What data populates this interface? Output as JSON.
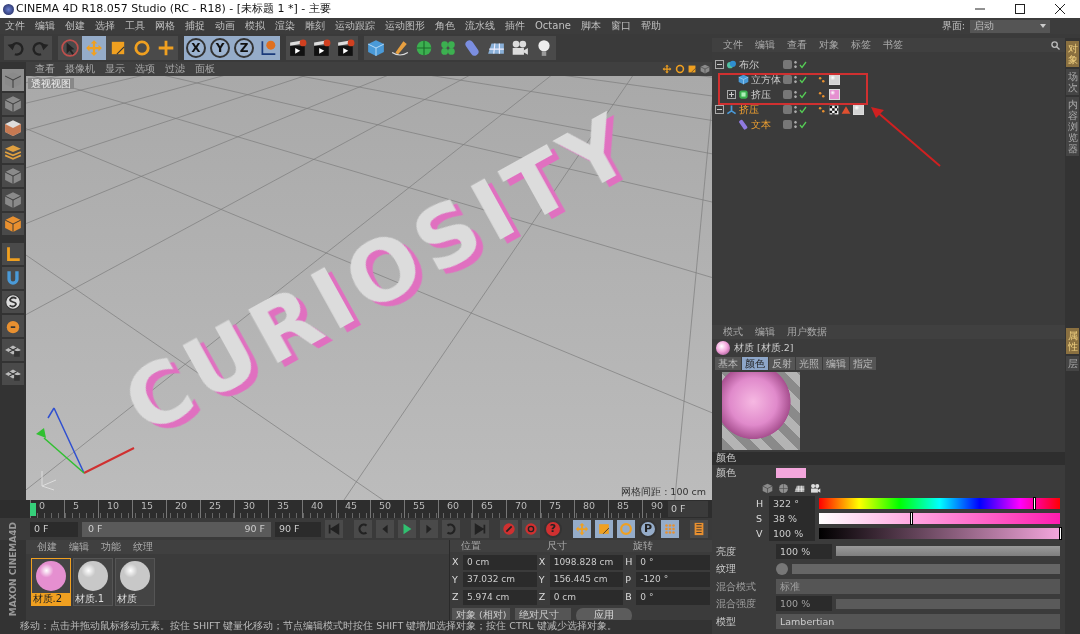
{
  "window": {
    "title": "CINEMA 4D R18.057 Studio (RC - R18) - [未标题 1 *] - 主要"
  },
  "menu": [
    "文件",
    "编辑",
    "创建",
    "选择",
    "工具",
    "网格",
    "捕捉",
    "动画",
    "模拟",
    "渲染",
    "雕刻",
    "运动跟踪",
    "运动图形",
    "角色",
    "流水线",
    "插件",
    "Octane",
    "脚本",
    "窗口",
    "帮助"
  ],
  "layout": {
    "label": "界面:",
    "value": "启动"
  },
  "toolbar": [
    {
      "kind": "undo",
      "selected": false
    },
    {
      "kind": "redo",
      "selected": false
    },
    {
      "kind": "sep"
    },
    {
      "kind": "select",
      "selected": false
    },
    {
      "kind": "move",
      "selected": true
    },
    {
      "kind": "scale",
      "selected": false
    },
    {
      "kind": "rotate",
      "selected": false
    },
    {
      "kind": "plus",
      "selected": false
    },
    {
      "kind": "sep"
    },
    {
      "kind": "axis",
      "label": "X",
      "selected": true
    },
    {
      "kind": "axis",
      "label": "Y",
      "selected": true
    },
    {
      "kind": "axis",
      "label": "Z",
      "selected": true
    },
    {
      "kind": "coords",
      "selected": true
    },
    {
      "kind": "sep"
    },
    {
      "kind": "clapper",
      "selected": false
    },
    {
      "kind": "clapper",
      "selected": false
    },
    {
      "kind": "clapper",
      "selected": false
    },
    {
      "kind": "sep"
    },
    {
      "kind": "cube",
      "selected": false
    },
    {
      "kind": "pen",
      "selected": false
    },
    {
      "kind": "subdiv",
      "selected": false
    },
    {
      "kind": "cloner",
      "selected": false
    },
    {
      "kind": "deformer",
      "selected": false
    },
    {
      "kind": "floor",
      "selected": false
    },
    {
      "kind": "camera",
      "selected": false
    },
    {
      "kind": "light",
      "selected": false
    }
  ],
  "left_tools": [
    {
      "kind": "cube-grey",
      "selected": true
    },
    {
      "kind": "cube-grey",
      "selected": false
    },
    {
      "kind": "checker",
      "selected": false
    },
    {
      "kind": "plates",
      "selected": false
    },
    {
      "kind": "cube-grey",
      "selected": false
    },
    {
      "kind": "cube-grey",
      "selected": false
    },
    {
      "kind": "cube-orange",
      "selected": false
    },
    {
      "kind": "sep"
    },
    {
      "kind": "axis-l",
      "selected": false
    },
    {
      "kind": "magnet",
      "selected": false
    },
    {
      "kind": "s-circle",
      "selected": false
    },
    {
      "kind": "lock",
      "selected": false
    },
    {
      "kind": "grid-lock",
      "selected": false
    },
    {
      "kind": "grid-lock",
      "selected": false
    }
  ],
  "viewport": {
    "menu": [
      "查看",
      "摄像机",
      "显示",
      "选项",
      "过滤",
      "面板"
    ],
    "view_name": "透视视图",
    "model_text": "CURIOSITY",
    "grid_spacing": "网格间距 : 100 cm"
  },
  "timeline": {
    "ticks": [
      "0",
      "5",
      "10",
      "15",
      "20",
      "25",
      "30",
      "35",
      "40",
      "45",
      "50",
      "55",
      "60",
      "65",
      "70",
      "75",
      "80",
      "85",
      "90"
    ],
    "level": 0,
    "current": "0 F"
  },
  "playback": {
    "start": "0 F",
    "range_start": "0 F",
    "range_end": "90 F",
    "end": "90 F",
    "controls": [
      {
        "kind": "to-start",
        "selected": false
      },
      {
        "kind": "sep"
      },
      {
        "kind": "prev-key",
        "selected": false
      },
      {
        "kind": "prev-frame",
        "selected": false
      },
      {
        "kind": "play",
        "selected": false
      },
      {
        "kind": "next-frame",
        "selected": false
      },
      {
        "kind": "next-key",
        "selected": false
      },
      {
        "kind": "sep"
      },
      {
        "kind": "to-end",
        "selected": false
      },
      {
        "kind": "sep"
      },
      {
        "kind": "record",
        "selected": false
      },
      {
        "kind": "autokey",
        "selected": false
      },
      {
        "kind": "keyhelp",
        "label": "?",
        "selected": false
      },
      {
        "kind": "sep"
      },
      {
        "kind": "move",
        "selected": true
      },
      {
        "kind": "scale",
        "selected": true
      },
      {
        "kind": "rotate",
        "selected": true
      },
      {
        "kind": "param",
        "label": "P",
        "selected": true
      },
      {
        "kind": "dots",
        "selected": true
      },
      {
        "kind": "sep"
      },
      {
        "kind": "film",
        "selected": false
      }
    ]
  },
  "materials": {
    "menu": [
      "创建",
      "编辑",
      "功能",
      "纹理"
    ],
    "items": [
      {
        "name": "材质.2",
        "color": "#e58fd0",
        "selected": true
      },
      {
        "name": "材质.1",
        "color": "#c8c8c8",
        "selected": false
      },
      {
        "name": "材质",
        "color": "#c8c8c8",
        "selected": false
      }
    ]
  },
  "coordinates": {
    "headers": [
      "位置",
      "尺寸",
      "旋转"
    ],
    "rows": [
      [
        {
          "axis": "X",
          "value": "0 cm"
        },
        {
          "axis": "X",
          "value": "1098.828 cm"
        },
        {
          "axis": "H",
          "value": "0 °"
        }
      ],
      [
        {
          "axis": "Y",
          "value": "37.032 cm"
        },
        {
          "axis": "Y",
          "value": "156.445 cm"
        },
        {
          "axis": "P",
          "value": "-120 °"
        }
      ],
      [
        {
          "axis": "Z",
          "value": "5.974 cm"
        },
        {
          "axis": "Z",
          "value": "0 cm"
        },
        {
          "axis": "B",
          "value": "0 °"
        }
      ]
    ],
    "mode": "对象 (相对)",
    "size_mode": "绝对尺寸",
    "apply": "应用"
  },
  "brand": {
    "top": "MAXON",
    "bottom": "CINEMA4D"
  },
  "status_bar": "移动：点击并拖动鼠标移动元素。按住 SHIFT 键量化移动；节点编辑模式时按住 SHIFT 键增加选择对象；按住 CTRL 键减少选择对象。",
  "objects": {
    "menu": [
      "文件",
      "编辑",
      "查看",
      "对象",
      "标签",
      "书签"
    ],
    "tree": [
      {
        "name": "布尔",
        "kind": "boole",
        "selected": false,
        "expanded": true,
        "children": [
          {
            "name": "立方体",
            "kind": "cube",
            "selected": false,
            "tags": [
              {
                "kind": "phong"
              },
              {
                "kind": "material",
                "color": "#d4d4d4"
              }
            ]
          },
          {
            "name": "挤压",
            "kind": "extrude",
            "selected": false,
            "expanded": false,
            "tags": [
              {
                "kind": "phong"
              },
              {
                "kind": "material",
                "color": "#e58fd0"
              }
            ]
          }
        ]
      },
      {
        "name": "挤压",
        "kind": "extrude-gizmo",
        "selected": true,
        "expanded": true,
        "tags": [
          {
            "kind": "phong"
          },
          {
            "kind": "checker"
          },
          {
            "kind": "warning"
          },
          {
            "kind": "material",
            "color": "#d4d4d4"
          }
        ],
        "children": [
          {
            "name": "文本",
            "kind": "spline",
            "selected": true
          }
        ]
      }
    ]
  },
  "object_tabs": [
    {
      "label": "对象",
      "selected": true
    },
    {
      "label": "场次",
      "selected": false
    },
    {
      "label": "内容浏览器",
      "selected": false
    }
  ],
  "attributes": {
    "menu": [
      "模式",
      "编辑",
      "用户数据"
    ],
    "title": "材质 [材质.2]",
    "tabs": [
      {
        "label": "基本",
        "selected": false
      },
      {
        "label": "颜色",
        "selected": true
      },
      {
        "label": "反射",
        "selected": false
      },
      {
        "label": "光照",
        "selected": false
      },
      {
        "label": "编辑",
        "selected": false
      },
      {
        "label": "指定",
        "selected": false
      }
    ],
    "section": "颜色",
    "color_field": {
      "label": "颜色",
      "color": "#f4a6dc"
    },
    "hsv": [
      {
        "axis": "H",
        "value": "322 °",
        "kind": "hue",
        "level": 0.894
      },
      {
        "axis": "S",
        "value": "38 %",
        "kind": "saturation",
        "level": 0.38
      },
      {
        "axis": "V",
        "value": "100 %",
        "kind": "value",
        "level": 1
      }
    ],
    "params": [
      {
        "label": "亮度",
        "kind": "slider",
        "value": "100 %",
        "level": 1,
        "disabled": false
      },
      {
        "label": "纹理",
        "kind": "texture",
        "disabled": false
      },
      {
        "label": "混合模式",
        "kind": "dropdown",
        "value": "标准",
        "disabled": true
      },
      {
        "label": "混合强度",
        "kind": "slider",
        "value": "100 %",
        "level": 1,
        "disabled": true
      },
      {
        "label": "模型",
        "kind": "dropdown",
        "value": "Lambertian",
        "disabled": false
      }
    ]
  },
  "attribute_tabs": [
    {
      "label": "属性",
      "selected": true
    },
    {
      "label": "层",
      "selected": false
    }
  ]
}
